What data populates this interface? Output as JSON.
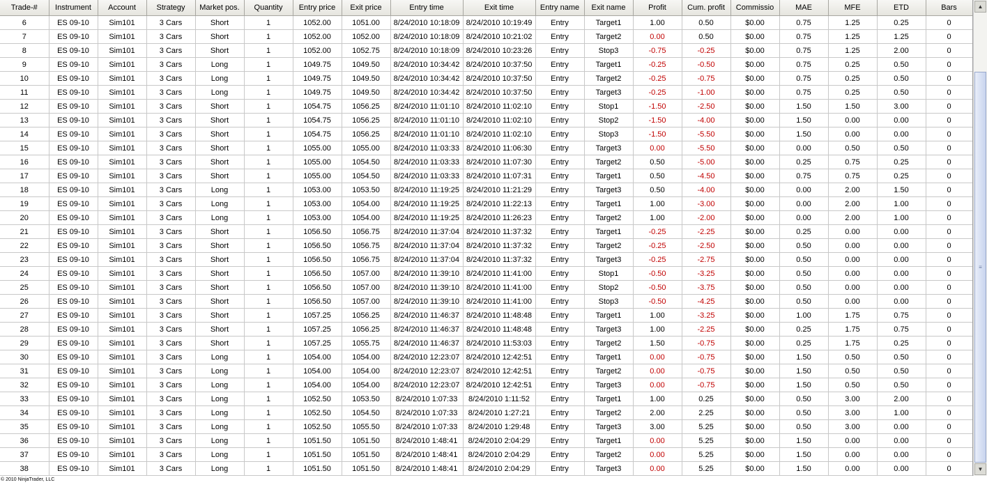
{
  "columns": [
    "Trade-#",
    "Instrument",
    "Account",
    "Strategy",
    "Market pos.",
    "Quantity",
    "Entry price",
    "Exit price",
    "Entry time",
    "Exit time",
    "Entry name",
    "Exit name",
    "Profit",
    "Cum. profit",
    "Commissio",
    "MAE",
    "MFE",
    "ETD",
    "Bars"
  ],
  "rows": [
    [
      "6",
      "ES 09-10",
      "Sim101",
      "3 Cars",
      "Short",
      "1",
      "1052.00",
      "1051.00",
      "8/24/2010 10:18:09",
      "8/24/2010 10:19:49",
      "Entry",
      "Target1",
      "1.00",
      "0.50",
      "$0.00",
      "0.75",
      "1.25",
      "0.25",
      "0"
    ],
    [
      "7",
      "ES 09-10",
      "Sim101",
      "3 Cars",
      "Short",
      "1",
      "1052.00",
      "1052.00",
      "8/24/2010 10:18:09",
      "8/24/2010 10:21:02",
      "Entry",
      "Target2",
      "0.00",
      "0.50",
      "$0.00",
      "0.75",
      "1.25",
      "1.25",
      "0"
    ],
    [
      "8",
      "ES 09-10",
      "Sim101",
      "3 Cars",
      "Short",
      "1",
      "1052.00",
      "1052.75",
      "8/24/2010 10:18:09",
      "8/24/2010 10:23:26",
      "Entry",
      "Stop3",
      "-0.75",
      "-0.25",
      "$0.00",
      "0.75",
      "1.25",
      "2.00",
      "0"
    ],
    [
      "9",
      "ES 09-10",
      "Sim101",
      "3 Cars",
      "Long",
      "1",
      "1049.75",
      "1049.50",
      "8/24/2010 10:34:42",
      "8/24/2010 10:37:50",
      "Entry",
      "Target1",
      "-0.25",
      "-0.50",
      "$0.00",
      "0.75",
      "0.25",
      "0.50",
      "0"
    ],
    [
      "10",
      "ES 09-10",
      "Sim101",
      "3 Cars",
      "Long",
      "1",
      "1049.75",
      "1049.50",
      "8/24/2010 10:34:42",
      "8/24/2010 10:37:50",
      "Entry",
      "Target2",
      "-0.25",
      "-0.75",
      "$0.00",
      "0.75",
      "0.25",
      "0.50",
      "0"
    ],
    [
      "11",
      "ES 09-10",
      "Sim101",
      "3 Cars",
      "Long",
      "1",
      "1049.75",
      "1049.50",
      "8/24/2010 10:34:42",
      "8/24/2010 10:37:50",
      "Entry",
      "Target3",
      "-0.25",
      "-1.00",
      "$0.00",
      "0.75",
      "0.25",
      "0.50",
      "0"
    ],
    [
      "12",
      "ES 09-10",
      "Sim101",
      "3 Cars",
      "Short",
      "1",
      "1054.75",
      "1056.25",
      "8/24/2010 11:01:10",
      "8/24/2010 11:02:10",
      "Entry",
      "Stop1",
      "-1.50",
      "-2.50",
      "$0.00",
      "1.50",
      "1.50",
      "3.00",
      "0"
    ],
    [
      "13",
      "ES 09-10",
      "Sim101",
      "3 Cars",
      "Short",
      "1",
      "1054.75",
      "1056.25",
      "8/24/2010 11:01:10",
      "8/24/2010 11:02:10",
      "Entry",
      "Stop2",
      "-1.50",
      "-4.00",
      "$0.00",
      "1.50",
      "0.00",
      "0.00",
      "0"
    ],
    [
      "14",
      "ES 09-10",
      "Sim101",
      "3 Cars",
      "Short",
      "1",
      "1054.75",
      "1056.25",
      "8/24/2010 11:01:10",
      "8/24/2010 11:02:10",
      "Entry",
      "Stop3",
      "-1.50",
      "-5.50",
      "$0.00",
      "1.50",
      "0.00",
      "0.00",
      "0"
    ],
    [
      "15",
      "ES 09-10",
      "Sim101",
      "3 Cars",
      "Short",
      "1",
      "1055.00",
      "1055.00",
      "8/24/2010 11:03:33",
      "8/24/2010 11:06:30",
      "Entry",
      "Target3",
      "0.00",
      "-5.50",
      "$0.00",
      "0.00",
      "0.50",
      "0.50",
      "0"
    ],
    [
      "16",
      "ES 09-10",
      "Sim101",
      "3 Cars",
      "Short",
      "1",
      "1055.00",
      "1054.50",
      "8/24/2010 11:03:33",
      "8/24/2010 11:07:30",
      "Entry",
      "Target2",
      "0.50",
      "-5.00",
      "$0.00",
      "0.25",
      "0.75",
      "0.25",
      "0"
    ],
    [
      "17",
      "ES 09-10",
      "Sim101",
      "3 Cars",
      "Short",
      "1",
      "1055.00",
      "1054.50",
      "8/24/2010 11:03:33",
      "8/24/2010 11:07:31",
      "Entry",
      "Target1",
      "0.50",
      "-4.50",
      "$0.00",
      "0.75",
      "0.75",
      "0.25",
      "0"
    ],
    [
      "18",
      "ES 09-10",
      "Sim101",
      "3 Cars",
      "Long",
      "1",
      "1053.00",
      "1053.50",
      "8/24/2010 11:19:25",
      "8/24/2010 11:21:29",
      "Entry",
      "Target3",
      "0.50",
      "-4.00",
      "$0.00",
      "0.00",
      "2.00",
      "1.50",
      "0"
    ],
    [
      "19",
      "ES 09-10",
      "Sim101",
      "3 Cars",
      "Long",
      "1",
      "1053.00",
      "1054.00",
      "8/24/2010 11:19:25",
      "8/24/2010 11:22:13",
      "Entry",
      "Target1",
      "1.00",
      "-3.00",
      "$0.00",
      "0.00",
      "2.00",
      "1.00",
      "0"
    ],
    [
      "20",
      "ES 09-10",
      "Sim101",
      "3 Cars",
      "Long",
      "1",
      "1053.00",
      "1054.00",
      "8/24/2010 11:19:25",
      "8/24/2010 11:26:23",
      "Entry",
      "Target2",
      "1.00",
      "-2.00",
      "$0.00",
      "0.00",
      "2.00",
      "1.00",
      "0"
    ],
    [
      "21",
      "ES 09-10",
      "Sim101",
      "3 Cars",
      "Short",
      "1",
      "1056.50",
      "1056.75",
      "8/24/2010 11:37:04",
      "8/24/2010 11:37:32",
      "Entry",
      "Target1",
      "-0.25",
      "-2.25",
      "$0.00",
      "0.25",
      "0.00",
      "0.00",
      "0"
    ],
    [
      "22",
      "ES 09-10",
      "Sim101",
      "3 Cars",
      "Short",
      "1",
      "1056.50",
      "1056.75",
      "8/24/2010 11:37:04",
      "8/24/2010 11:37:32",
      "Entry",
      "Target2",
      "-0.25",
      "-2.50",
      "$0.00",
      "0.50",
      "0.00",
      "0.00",
      "0"
    ],
    [
      "23",
      "ES 09-10",
      "Sim101",
      "3 Cars",
      "Short",
      "1",
      "1056.50",
      "1056.75",
      "8/24/2010 11:37:04",
      "8/24/2010 11:37:32",
      "Entry",
      "Target3",
      "-0.25",
      "-2.75",
      "$0.00",
      "0.50",
      "0.00",
      "0.00",
      "0"
    ],
    [
      "24",
      "ES 09-10",
      "Sim101",
      "3 Cars",
      "Short",
      "1",
      "1056.50",
      "1057.00",
      "8/24/2010 11:39:10",
      "8/24/2010 11:41:00",
      "Entry",
      "Stop1",
      "-0.50",
      "-3.25",
      "$0.00",
      "0.50",
      "0.00",
      "0.00",
      "0"
    ],
    [
      "25",
      "ES 09-10",
      "Sim101",
      "3 Cars",
      "Short",
      "1",
      "1056.50",
      "1057.00",
      "8/24/2010 11:39:10",
      "8/24/2010 11:41:00",
      "Entry",
      "Stop2",
      "-0.50",
      "-3.75",
      "$0.00",
      "0.50",
      "0.00",
      "0.00",
      "0"
    ],
    [
      "26",
      "ES 09-10",
      "Sim101",
      "3 Cars",
      "Short",
      "1",
      "1056.50",
      "1057.00",
      "8/24/2010 11:39:10",
      "8/24/2010 11:41:00",
      "Entry",
      "Stop3",
      "-0.50",
      "-4.25",
      "$0.00",
      "0.50",
      "0.00",
      "0.00",
      "0"
    ],
    [
      "27",
      "ES 09-10",
      "Sim101",
      "3 Cars",
      "Short",
      "1",
      "1057.25",
      "1056.25",
      "8/24/2010 11:46:37",
      "8/24/2010 11:48:48",
      "Entry",
      "Target1",
      "1.00",
      "-3.25",
      "$0.00",
      "1.00",
      "1.75",
      "0.75",
      "0"
    ],
    [
      "28",
      "ES 09-10",
      "Sim101",
      "3 Cars",
      "Short",
      "1",
      "1057.25",
      "1056.25",
      "8/24/2010 11:46:37",
      "8/24/2010 11:48:48",
      "Entry",
      "Target3",
      "1.00",
      "-2.25",
      "$0.00",
      "0.25",
      "1.75",
      "0.75",
      "0"
    ],
    [
      "29",
      "ES 09-10",
      "Sim101",
      "3 Cars",
      "Short",
      "1",
      "1057.25",
      "1055.75",
      "8/24/2010 11:46:37",
      "8/24/2010 11:53:03",
      "Entry",
      "Target2",
      "1.50",
      "-0.75",
      "$0.00",
      "0.25",
      "1.75",
      "0.25",
      "0"
    ],
    [
      "30",
      "ES 09-10",
      "Sim101",
      "3 Cars",
      "Long",
      "1",
      "1054.00",
      "1054.00",
      "8/24/2010 12:23:07",
      "8/24/2010 12:42:51",
      "Entry",
      "Target1",
      "0.00",
      "-0.75",
      "$0.00",
      "1.50",
      "0.50",
      "0.50",
      "0"
    ],
    [
      "31",
      "ES 09-10",
      "Sim101",
      "3 Cars",
      "Long",
      "1",
      "1054.00",
      "1054.00",
      "8/24/2010 12:23:07",
      "8/24/2010 12:42:51",
      "Entry",
      "Target2",
      "0.00",
      "-0.75",
      "$0.00",
      "1.50",
      "0.50",
      "0.50",
      "0"
    ],
    [
      "32",
      "ES 09-10",
      "Sim101",
      "3 Cars",
      "Long",
      "1",
      "1054.00",
      "1054.00",
      "8/24/2010 12:23:07",
      "8/24/2010 12:42:51",
      "Entry",
      "Target3",
      "0.00",
      "-0.75",
      "$0.00",
      "1.50",
      "0.50",
      "0.50",
      "0"
    ],
    [
      "33",
      "ES 09-10",
      "Sim101",
      "3 Cars",
      "Long",
      "1",
      "1052.50",
      "1053.50",
      "8/24/2010 1:07:33",
      "8/24/2010 1:11:52",
      "Entry",
      "Target1",
      "1.00",
      "0.25",
      "$0.00",
      "0.50",
      "3.00",
      "2.00",
      "0"
    ],
    [
      "34",
      "ES 09-10",
      "Sim101",
      "3 Cars",
      "Long",
      "1",
      "1052.50",
      "1054.50",
      "8/24/2010 1:07:33",
      "8/24/2010 1:27:21",
      "Entry",
      "Target2",
      "2.00",
      "2.25",
      "$0.00",
      "0.50",
      "3.00",
      "1.00",
      "0"
    ],
    [
      "35",
      "ES 09-10",
      "Sim101",
      "3 Cars",
      "Long",
      "1",
      "1052.50",
      "1055.50",
      "8/24/2010 1:07:33",
      "8/24/2010 1:29:48",
      "Entry",
      "Target3",
      "3.00",
      "5.25",
      "$0.00",
      "0.50",
      "3.00",
      "0.00",
      "0"
    ],
    [
      "36",
      "ES 09-10",
      "Sim101",
      "3 Cars",
      "Long",
      "1",
      "1051.50",
      "1051.50",
      "8/24/2010 1:48:41",
      "8/24/2010 2:04:29",
      "Entry",
      "Target1",
      "0.00",
      "5.25",
      "$0.00",
      "1.50",
      "0.00",
      "0.00",
      "0"
    ],
    [
      "37",
      "ES 09-10",
      "Sim101",
      "3 Cars",
      "Long",
      "1",
      "1051.50",
      "1051.50",
      "8/24/2010 1:48:41",
      "8/24/2010 2:04:29",
      "Entry",
      "Target2",
      "0.00",
      "5.25",
      "$0.00",
      "1.50",
      "0.00",
      "0.00",
      "0"
    ],
    [
      "38",
      "ES 09-10",
      "Sim101",
      "3 Cars",
      "Long",
      "1",
      "1051.50",
      "1051.50",
      "8/24/2010 1:48:41",
      "8/24/2010 2:04:29",
      "Entry",
      "Target3",
      "0.00",
      "5.25",
      "$0.00",
      "1.50",
      "0.00",
      "0.00",
      "0"
    ]
  ],
  "colors": {
    "negative": "#c00000",
    "header_bg": "#ebeae4",
    "grid_line": "#c8c8c8"
  },
  "scrollbar": {
    "up_icon": "triangle-up",
    "down_icon": "triangle-down",
    "grip_icon": "grip-lines",
    "position_fraction": 0.17
  },
  "footer": {
    "copyright": "© 2010 NinjaTrader, LLC"
  }
}
